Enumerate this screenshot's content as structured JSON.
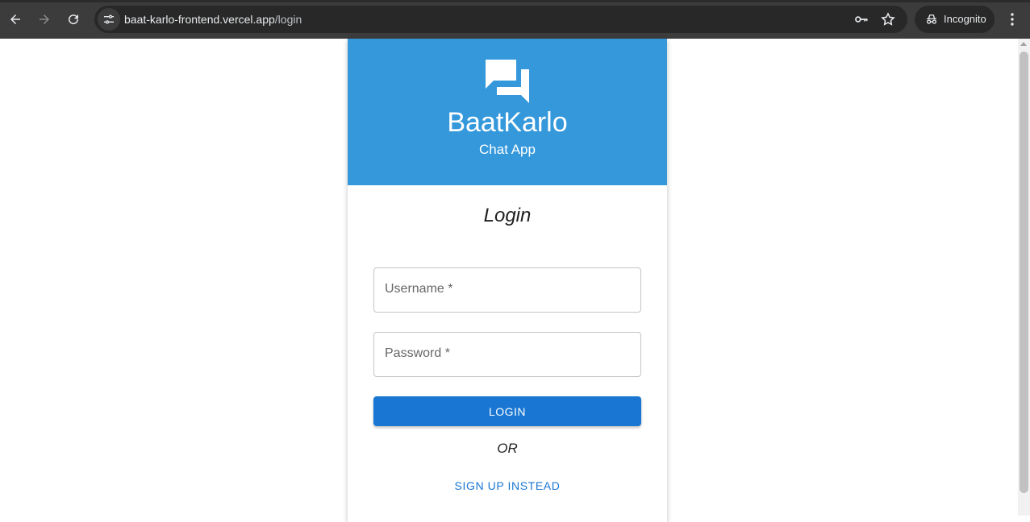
{
  "browser": {
    "url_host": "baat-karlo-frontend.vercel.app",
    "url_path": "/login",
    "incognito_label": "Incognito"
  },
  "app": {
    "brand": "BaatKarlo",
    "tagline": "Chat App",
    "header_color": "#3498db"
  },
  "login_form": {
    "title": "Login",
    "username_placeholder": "Username *",
    "password_placeholder": "Password *",
    "submit_label": "LOGIN",
    "or_text": "OR",
    "signup_label": "SIGN UP INSTEAD",
    "accent_color": "#1976d2"
  }
}
